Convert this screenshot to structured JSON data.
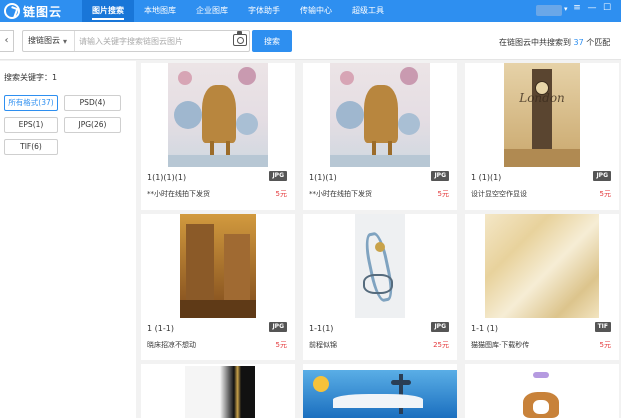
{
  "app": {
    "logo_text": "链图云"
  },
  "nav": {
    "items": [
      {
        "label": "图片搜索",
        "active": true
      },
      {
        "label": "本地图库",
        "active": false
      },
      {
        "label": "企业图库",
        "active": false
      },
      {
        "label": "字体助手",
        "active": false
      },
      {
        "label": "传输中心",
        "active": false
      },
      {
        "label": "超级工具",
        "active": false
      }
    ],
    "caret": "▾",
    "icons": [
      {
        "name": "menu-icon",
        "glyph": "≡"
      },
      {
        "name": "minimize-icon",
        "glyph": "—"
      },
      {
        "name": "maximize-icon",
        "glyph": "☐"
      }
    ]
  },
  "search": {
    "back_glyph": "‹",
    "scope_label": "搜链图云",
    "scope_caret": "▾",
    "placeholder": "请输入关键字搜索链图云图片",
    "button_label": "搜索",
    "result_prefix": "在链图云中共搜索到",
    "result_count": "37",
    "result_suffix": "个匹配"
  },
  "sidebar": {
    "keyword_label": "搜索关键字：1",
    "formats": [
      {
        "label": "所有格式(37)",
        "active": true
      },
      {
        "label": "PSD(4)",
        "active": false
      },
      {
        "label": "EPS(1)",
        "active": false
      },
      {
        "label": "JPG(26)",
        "active": false
      },
      {
        "label": "TIF(6)",
        "active": false
      }
    ]
  },
  "cards": [
    {
      "name": "1(1)(1)(1)",
      "badge": "JPG",
      "desc": "**小时在线拍下发货",
      "price": "5元",
      "image": "deer-flowers-art"
    },
    {
      "name": "1(1)(1)",
      "badge": "JPG",
      "desc": "**小时在线拍下发货",
      "price": "5元",
      "image": "deer-flowers-art"
    },
    {
      "name": "1 (1)(1)",
      "badge": "JPG",
      "desc": "设计显空空作显设",
      "price": "5元",
      "image": "london-clock-tower"
    },
    {
      "name": "1 (1-1)",
      "badge": "JPG",
      "desc": "晓床招凉不想动",
      "price": "5元",
      "image": "vintage-street"
    },
    {
      "name": "1-1(1)",
      "badge": "JPG",
      "desc": "前程似锦",
      "price": "25元",
      "image": "abstract-landscape"
    },
    {
      "name": "1-1 (1)",
      "badge": "TIF",
      "desc": "猫猫图库·下载秒传",
      "price": "5元",
      "image": "marble-texture"
    },
    {
      "image": "black-gold-abstract"
    },
    {
      "image": "city-skyline-cartoon"
    },
    {
      "image": "cartoon-dog"
    }
  ],
  "colors": {
    "accent": "#2e8ff0",
    "price": "#e4393c",
    "background": "#f2f2f2"
  }
}
